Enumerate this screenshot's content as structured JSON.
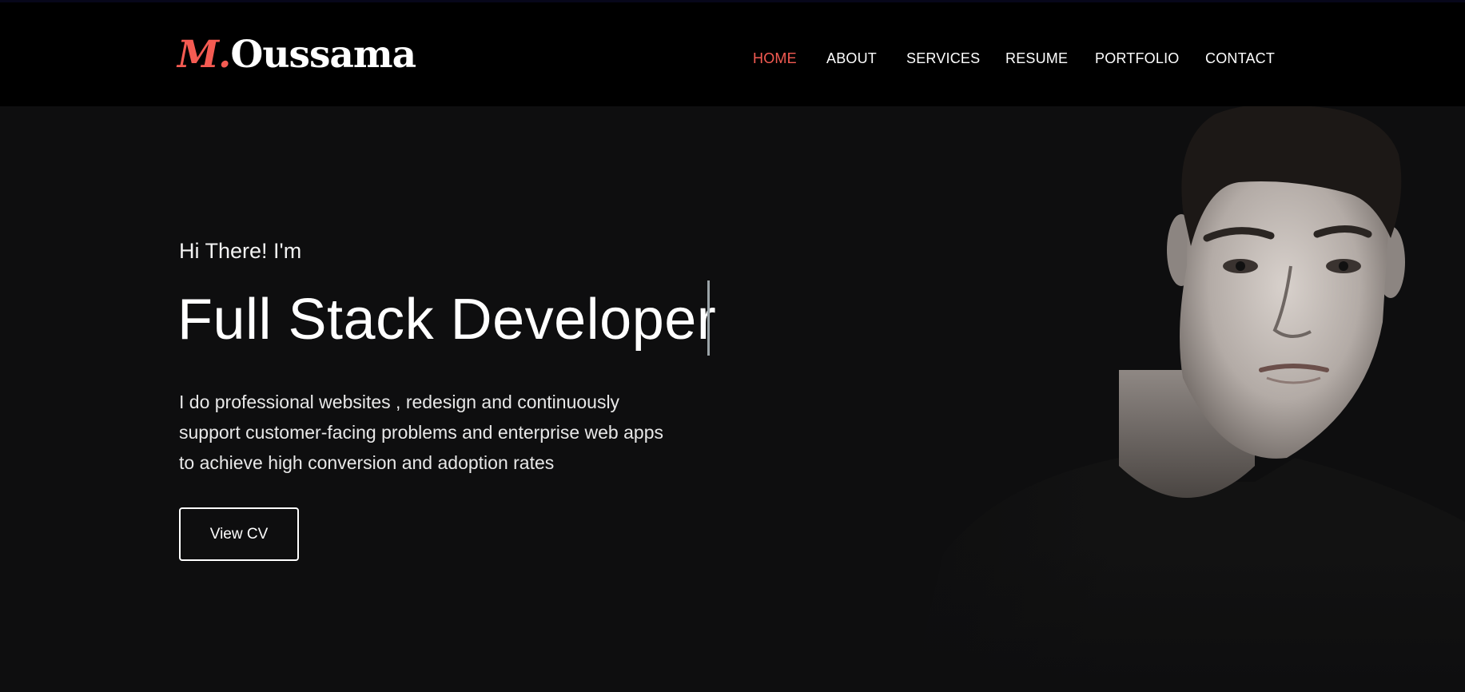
{
  "brand": {
    "initial": "M.",
    "name": "Oussama"
  },
  "nav": {
    "items": [
      {
        "label": "HOME",
        "active": true
      },
      {
        "label": "ABOUT",
        "active": false
      },
      {
        "label": "SERVICES",
        "active": false
      },
      {
        "label": "RESUME",
        "active": false
      },
      {
        "label": "PORTFOLIO",
        "active": false
      },
      {
        "label": "CONTACT",
        "active": false
      }
    ]
  },
  "hero": {
    "greeting": "Hi There! I'm",
    "headline": "Full Stack Developer",
    "description_lines": [
      "I do professional websites , redesign and continuously",
      "support customer-facing problems and enterprise web apps",
      "to achieve high conversion and adoption rates"
    ],
    "cta_label": "View CV",
    "portrait": "portrait-photo"
  },
  "colors": {
    "accent": "#f45b52",
    "navbar_bg": "#000000",
    "page_bg": "#0e0e0f",
    "text": "#ffffff"
  }
}
